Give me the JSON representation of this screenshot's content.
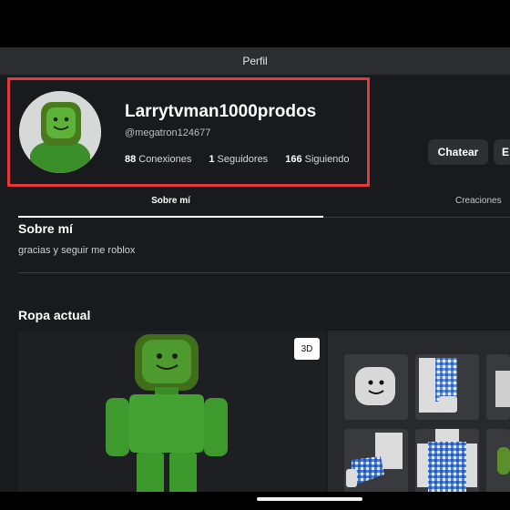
{
  "topbar": {
    "title": "Perfil"
  },
  "profile": {
    "display_name": "Larrytvman1000prodos",
    "handle": "@megatron124677",
    "connections_count": "88",
    "connections_label": "Conexiones",
    "followers_count": "1",
    "followers_label": "Seguidores",
    "following_count": "166",
    "following_label": "Siguiendo"
  },
  "actions": {
    "chat_label": "Chatear",
    "more_label": "E"
  },
  "tabs": [
    {
      "label": "Sobre mí",
      "active": true
    },
    {
      "label": "Creaciones",
      "active": false
    }
  ],
  "about": {
    "title": "Sobre mí",
    "text": "gracias y seguir me roblox"
  },
  "outfit": {
    "title": "Ropa actual",
    "view_toggle": "3D",
    "items": [
      "roblox-head-icon",
      "plaid-arm-icon",
      "blue-arm-icon",
      "plaid-shirt-icon",
      "extra-item-icon"
    ]
  },
  "colors": {
    "highlight": "#e5383b",
    "avatar_green": "#3d9a2c",
    "background": "#191a1d"
  }
}
